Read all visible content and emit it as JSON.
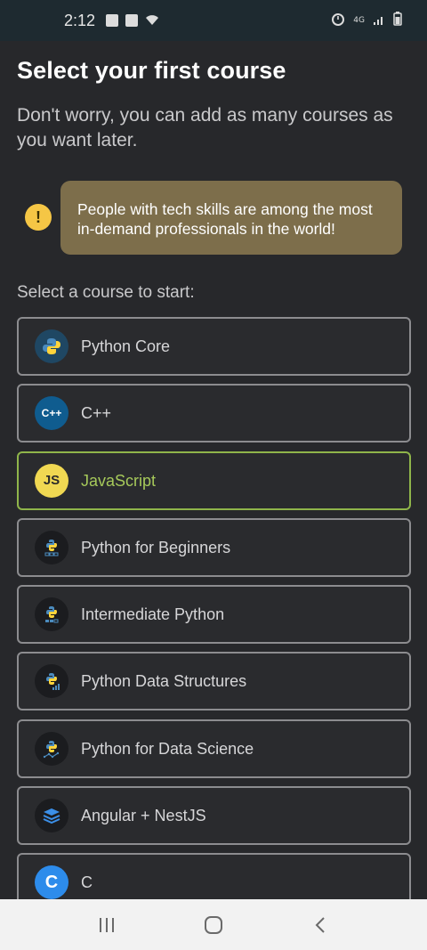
{
  "status_bar": {
    "time": "2:12",
    "network": "4G"
  },
  "header": {
    "title": "Select your first course",
    "subtitle": "Don't worry, you can add as many courses as you want later."
  },
  "tip": {
    "icon_text": "!",
    "text": "People with tech skills are among the most in-demand professionals in the world!"
  },
  "section_label": "Select a course to start:",
  "courses": [
    {
      "label": "Python Core",
      "icon": "python-icon",
      "selected": false
    },
    {
      "label": "C++",
      "icon": "cpp-icon",
      "icon_text": "C++",
      "selected": false
    },
    {
      "label": "JavaScript",
      "icon": "javascript-icon",
      "icon_text": "JS",
      "selected": true
    },
    {
      "label": "Python for Beginners",
      "icon": "python-beginners-icon",
      "selected": false
    },
    {
      "label": "Intermediate Python",
      "icon": "python-intermediate-icon",
      "selected": false
    },
    {
      "label": "Python Data Structures",
      "icon": "python-data-structures-icon",
      "selected": false
    },
    {
      "label": "Python for Data Science",
      "icon": "python-data-science-icon",
      "selected": false
    },
    {
      "label": "Angular + NestJS",
      "icon": "angular-nestjs-icon",
      "selected": false
    },
    {
      "label": "C",
      "icon": "c-icon",
      "icon_text": "C",
      "selected": false
    }
  ],
  "colors": {
    "background": "#27282b",
    "tip_bubble": "#7d6e4b",
    "tip_icon": "#f5c645",
    "selected_border": "#8fb54a",
    "selected_text": "#a6c95a",
    "border": "#8c8c8f"
  }
}
